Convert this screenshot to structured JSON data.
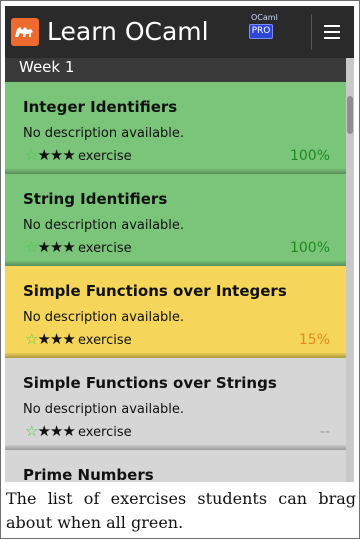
{
  "app": {
    "title": "Learn OCaml",
    "badge_small": "OCaml",
    "badge_pro": "PRO",
    "menu_icon": "hamburger-menu-icon",
    "logo_icon": "camel-logo-icon"
  },
  "section": {
    "label": "Week 1"
  },
  "exercises": [
    {
      "title": "Integer Identifiers",
      "description": "No description available.",
      "stars_filled": 3,
      "star_empty": 1,
      "type": "exercise",
      "progress": "100%",
      "bg": "#7bc57b",
      "progress_color": "#1e8a1e"
    },
    {
      "title": "String Identifiers",
      "description": "No description available.",
      "stars_filled": 3,
      "star_empty": 1,
      "type": "exercise",
      "progress": "100%",
      "bg": "#7bc57b",
      "progress_color": "#1e8a1e"
    },
    {
      "title": "Simple Functions over Integers",
      "description": "No description available.",
      "stars_filled": 3,
      "star_empty": 1,
      "type": "exercise",
      "progress": "15%",
      "bg": "#f6d65a",
      "progress_color": "#e08a1a"
    },
    {
      "title": "Simple Functions over Strings",
      "description": "No description available.",
      "stars_filled": 3,
      "star_empty": 1,
      "type": "exercise",
      "progress": "--",
      "bg": "#d6d6d6",
      "progress_color": "#9a9a9a"
    },
    {
      "title": "Prime Numbers",
      "description": "",
      "stars_filled": 0,
      "star_empty": 0,
      "type": "",
      "progress": "",
      "bg": "#d6d6d6",
      "progress_color": "#9a9a9a"
    }
  ],
  "caption": "The list of exercises students can brag about when all green.",
  "colors": {
    "appbar": "#2a2a2a",
    "section_header": "#3a3a3a",
    "green_star": "#44cc44"
  }
}
